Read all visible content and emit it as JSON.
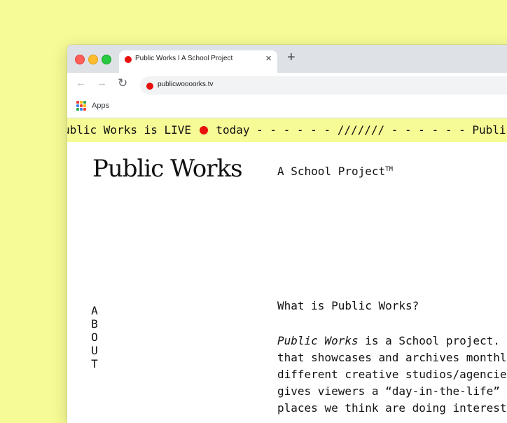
{
  "browser": {
    "tab_title": "Public Works I A School Project",
    "tab_close": "×",
    "new_tab": "+",
    "back": "←",
    "forward": "→",
    "reload": "↻",
    "url": "publicwoooorks.tv",
    "bookmark_apps": "Apps",
    "favicon_color": "#e8100c"
  },
  "ticker": {
    "before_dot": "ublic Works is LIVE",
    "after_dot": "today - - - - - - /////// - - - - - - Public Works is LIVE"
  },
  "site": {
    "title": "Public Works",
    "tagline": "A School Project",
    "tagline_mark": "TM",
    "about_vertical": "ABOUT",
    "section_heading": "What is Public Works?",
    "body": {
      "intro_italic": "Public Works",
      "line1_rest": " is a School project. I",
      "line2": "that showcases and archives monthly",
      "line3": "different creative studios/agencies",
      "line4": "gives viewers a “day-in-the-life” p",
      "line5": "places we think are doing interesti"
    }
  },
  "colors": {
    "background": "#f6fb95",
    "accent_red": "#e8100c",
    "text": "#111111"
  }
}
